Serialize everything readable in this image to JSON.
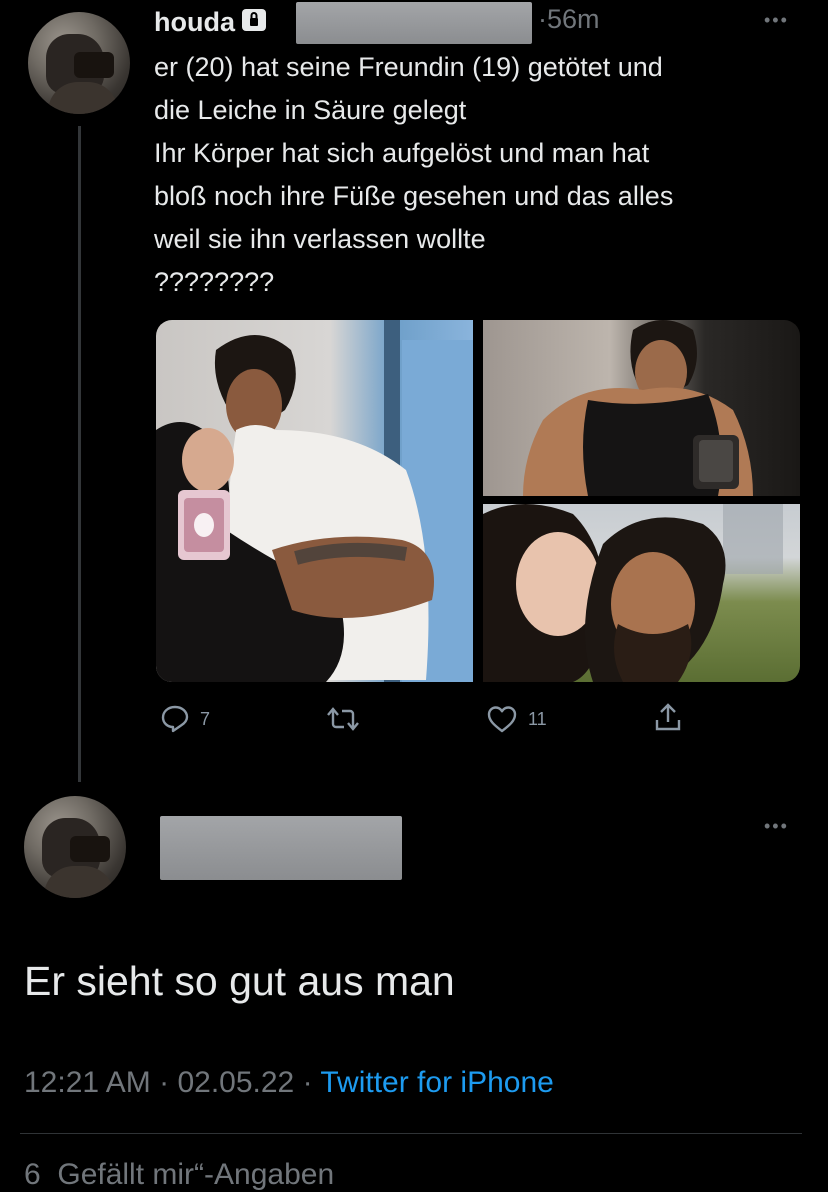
{
  "tweet": {
    "name": "houda",
    "time": "56m",
    "separator": "·",
    "text": "er (20) hat seine Freundin (19)  getötet und\ndie Leiche in Säure gelegt\nIhr Körper hat sich aufgelöst und man hat\nbloß noch ihre Füße gesehen und das alles\nweil sie ihn verlassen wollte\n????????",
    "more": "•••",
    "actions": {
      "reply_count": "7",
      "like_count": "11"
    },
    "photos": [
      {
        "icon": "mirror-selfie-couple-image"
      },
      {
        "icon": "gym-mirror-selfie-image"
      },
      {
        "icon": "couple-selfie-image"
      }
    ]
  },
  "reply": {
    "more": "•••",
    "text": "Er sieht so gut aus man",
    "time": "12:21 AM",
    "date": "02.05.22",
    "separator": "·",
    "source": "Twitter for iPhone",
    "bottom_cut": "6  Gefällt mir“-Angaben"
  },
  "colors": {
    "background": "#000000",
    "text": "#e7e9ea",
    "secondary": "#71767b",
    "link": "#1d9bf0"
  }
}
